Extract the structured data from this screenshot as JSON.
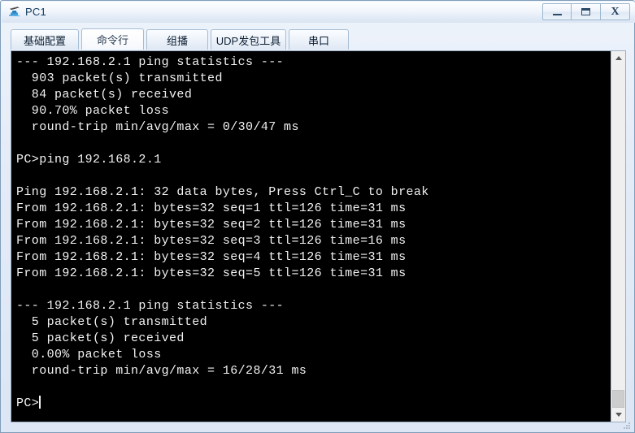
{
  "window": {
    "title": "PC1",
    "icon": "pc-device-icon",
    "controls": {
      "minimize_label": "Minimize",
      "maximize_label": "Maximize",
      "close_label": "X"
    }
  },
  "tabs": [
    {
      "label": "基础配置",
      "active": false,
      "name": "tab-basic-config"
    },
    {
      "label": "命令行",
      "active": true,
      "name": "tab-command-line"
    },
    {
      "label": "组播",
      "active": false,
      "name": "tab-multicast"
    },
    {
      "label": "UDP发包工具",
      "active": false,
      "name": "tab-udp-tool"
    },
    {
      "label": "串口",
      "active": false,
      "name": "tab-serial-port"
    }
  ],
  "terminal": {
    "background_color": "#000000",
    "text_color": "#f2f2f2",
    "prompt": "PC>",
    "cursor_visible": true,
    "lines": [
      "--- 192.168.2.1 ping statistics ---",
      "  903 packet(s) transmitted",
      "  84 packet(s) received",
      "  90.70% packet loss",
      "  round-trip min/avg/max = 0/30/47 ms",
      "",
      "PC>ping 192.168.2.1",
      "",
      "Ping 192.168.2.1: 32 data bytes, Press Ctrl_C to break",
      "From 192.168.2.1: bytes=32 seq=1 ttl=126 time=31 ms",
      "From 192.168.2.1: bytes=32 seq=2 ttl=126 time=31 ms",
      "From 192.168.2.1: bytes=32 seq=3 ttl=126 time=16 ms",
      "From 192.168.2.1: bytes=32 seq=4 ttl=126 time=31 ms",
      "From 192.168.2.1: bytes=32 seq=5 ttl=126 time=31 ms",
      "",
      "--- 192.168.2.1 ping statistics ---",
      "  5 packet(s) transmitted",
      "  5 packet(s) received",
      "  0.00% packet loss",
      "  round-trip min/avg/max = 16/28/31 ms",
      ""
    ],
    "ping_sessions": [
      {
        "target": "192.168.2.1",
        "transmitted": 903,
        "received": 84,
        "packet_loss_percent": "90.70%",
        "rtt_min_ms": 0,
        "rtt_avg_ms": 30,
        "rtt_max_ms": 47
      },
      {
        "target": "192.168.2.1",
        "command": "ping 192.168.2.1",
        "header": "Ping 192.168.2.1: 32 data bytes, Press Ctrl_C to break",
        "data_bytes": 32,
        "replies": [
          {
            "from": "192.168.2.1",
            "bytes": 32,
            "seq": 1,
            "ttl": 126,
            "time_ms": 31
          },
          {
            "from": "192.168.2.1",
            "bytes": 32,
            "seq": 2,
            "ttl": 126,
            "time_ms": 31
          },
          {
            "from": "192.168.2.1",
            "bytes": 32,
            "seq": 3,
            "ttl": 126,
            "time_ms": 16
          },
          {
            "from": "192.168.2.1",
            "bytes": 32,
            "seq": 4,
            "ttl": 126,
            "time_ms": 31
          },
          {
            "from": "192.168.2.1",
            "bytes": 32,
            "seq": 5,
            "ttl": 126,
            "time_ms": 31
          }
        ],
        "transmitted": 5,
        "received": 5,
        "packet_loss_percent": "0.00%",
        "rtt_min_ms": 16,
        "rtt_avg_ms": 28,
        "rtt_max_ms": 31
      }
    ]
  },
  "scrollbar": {
    "orientation": "vertical",
    "up_icon": "chevron-up-icon",
    "down_icon": "chevron-down-icon",
    "thumb_position": "bottom"
  }
}
